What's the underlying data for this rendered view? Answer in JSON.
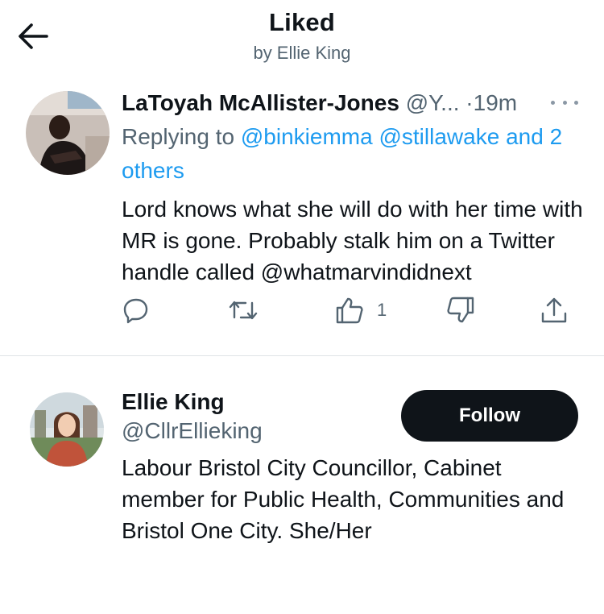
{
  "header": {
    "title": "Liked",
    "subtitle": "by Ellie King"
  },
  "tweet": {
    "author_name": "LaToyah McAllister-Jones",
    "author_handle": "@Y...",
    "separator": "·",
    "time": "19m",
    "replying_prefix": "Replying to",
    "mentions": [
      "@binkiemma",
      "@stillawake"
    ],
    "replying_and": "and",
    "replying_others": "2 others",
    "text": "Lord knows what she will do with her time with MR is gone. Probably stalk him on a Twitter handle called @whatmarvindidnext",
    "like_count": "1",
    "icons": [
      "reply-icon",
      "retweet-icon",
      "like-icon",
      "dislike-icon",
      "share-icon",
      "more-icon"
    ]
  },
  "user_cell": {
    "name": "Ellie King",
    "handle": "@CllrEllieking",
    "follow_label": "Follow",
    "bio": "Labour Bristol City Councillor, Cabinet member for Public Health, Communities and Bristol One City. She/Her"
  },
  "colors": {
    "text": "#0f1419",
    "secondary": "#536471",
    "link": "#1d9bf0",
    "follow_bg": "#0f1419",
    "divider": "#dfe3e6"
  }
}
